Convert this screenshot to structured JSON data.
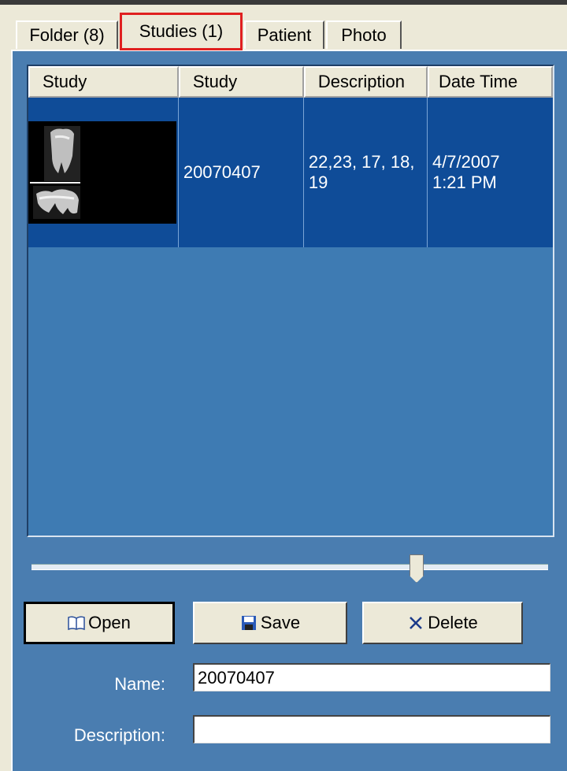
{
  "tabs": [
    {
      "label": "Folder (8)"
    },
    {
      "label": "Studies (1)"
    },
    {
      "label": "Patient"
    },
    {
      "label": "Photo"
    }
  ],
  "list": {
    "columns": [
      "Study",
      "Study",
      "Description",
      "Date Time"
    ],
    "rows": [
      {
        "study": "20070407",
        "description": "22,23, 17, 18, 19",
        "date_time": "4/7/2007 1:21 PM"
      }
    ]
  },
  "buttons": {
    "open": "Open",
    "save": "Save",
    "delete": "Delete"
  },
  "form": {
    "name_label": "Name:",
    "name_value": "20070407",
    "description_label": "Description:",
    "description_value": ""
  },
  "icons": {
    "open": "open-book-icon",
    "save": "floppy-disk-icon",
    "delete": "x-icon"
  },
  "colors": {
    "panel": "#4a7db0",
    "selected_row": "#0f4c98",
    "active_tab_outline": "#e02020"
  }
}
